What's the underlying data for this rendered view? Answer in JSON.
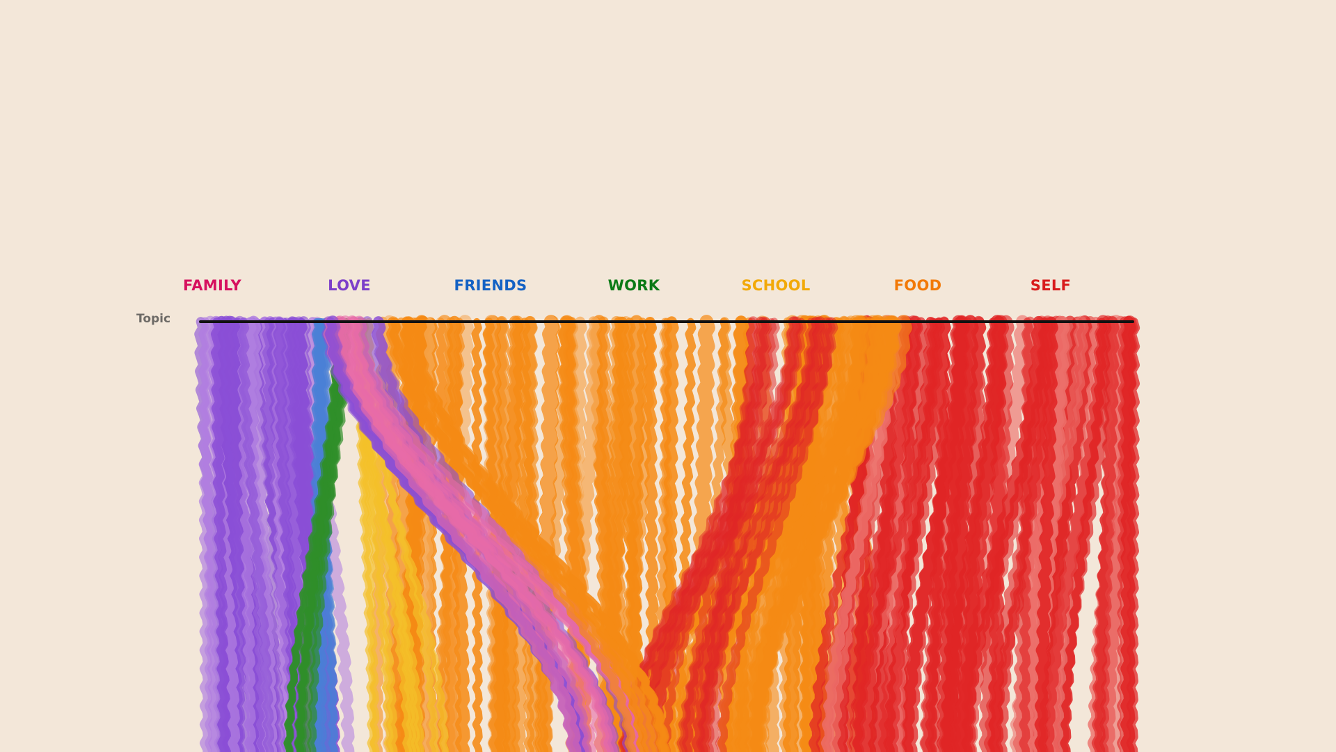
{
  "legend": {
    "topics": [
      {
        "id": "family",
        "label": "FAMILY",
        "color": "#d6105f"
      },
      {
        "id": "love",
        "label": "LOVE",
        "color": "#7c3fc9"
      },
      {
        "id": "friends",
        "label": "FRIENDS",
        "color": "#1462c4"
      },
      {
        "id": "work",
        "label": "WORK",
        "color": "#0b7a16"
      },
      {
        "id": "school",
        "label": "SCHOOL",
        "color": "#f2a908"
      },
      {
        "id": "food",
        "label": "FOOD",
        "color": "#f27907"
      },
      {
        "id": "self",
        "label": "SELF",
        "color": "#d81c1c"
      }
    ]
  },
  "axis": {
    "label": "Topic"
  },
  "visual_colors": {
    "purple": "#8a4fd6",
    "lilac": "#b07ee0",
    "blue": "#4a7fd6",
    "green": "#2f8f2a",
    "yellow": "#f4c02a",
    "orange": "#f58a14",
    "light_orange": "#f5a957",
    "pink": "#e86aa8",
    "red": "#e02525",
    "light_red": "#ec6f6a"
  }
}
